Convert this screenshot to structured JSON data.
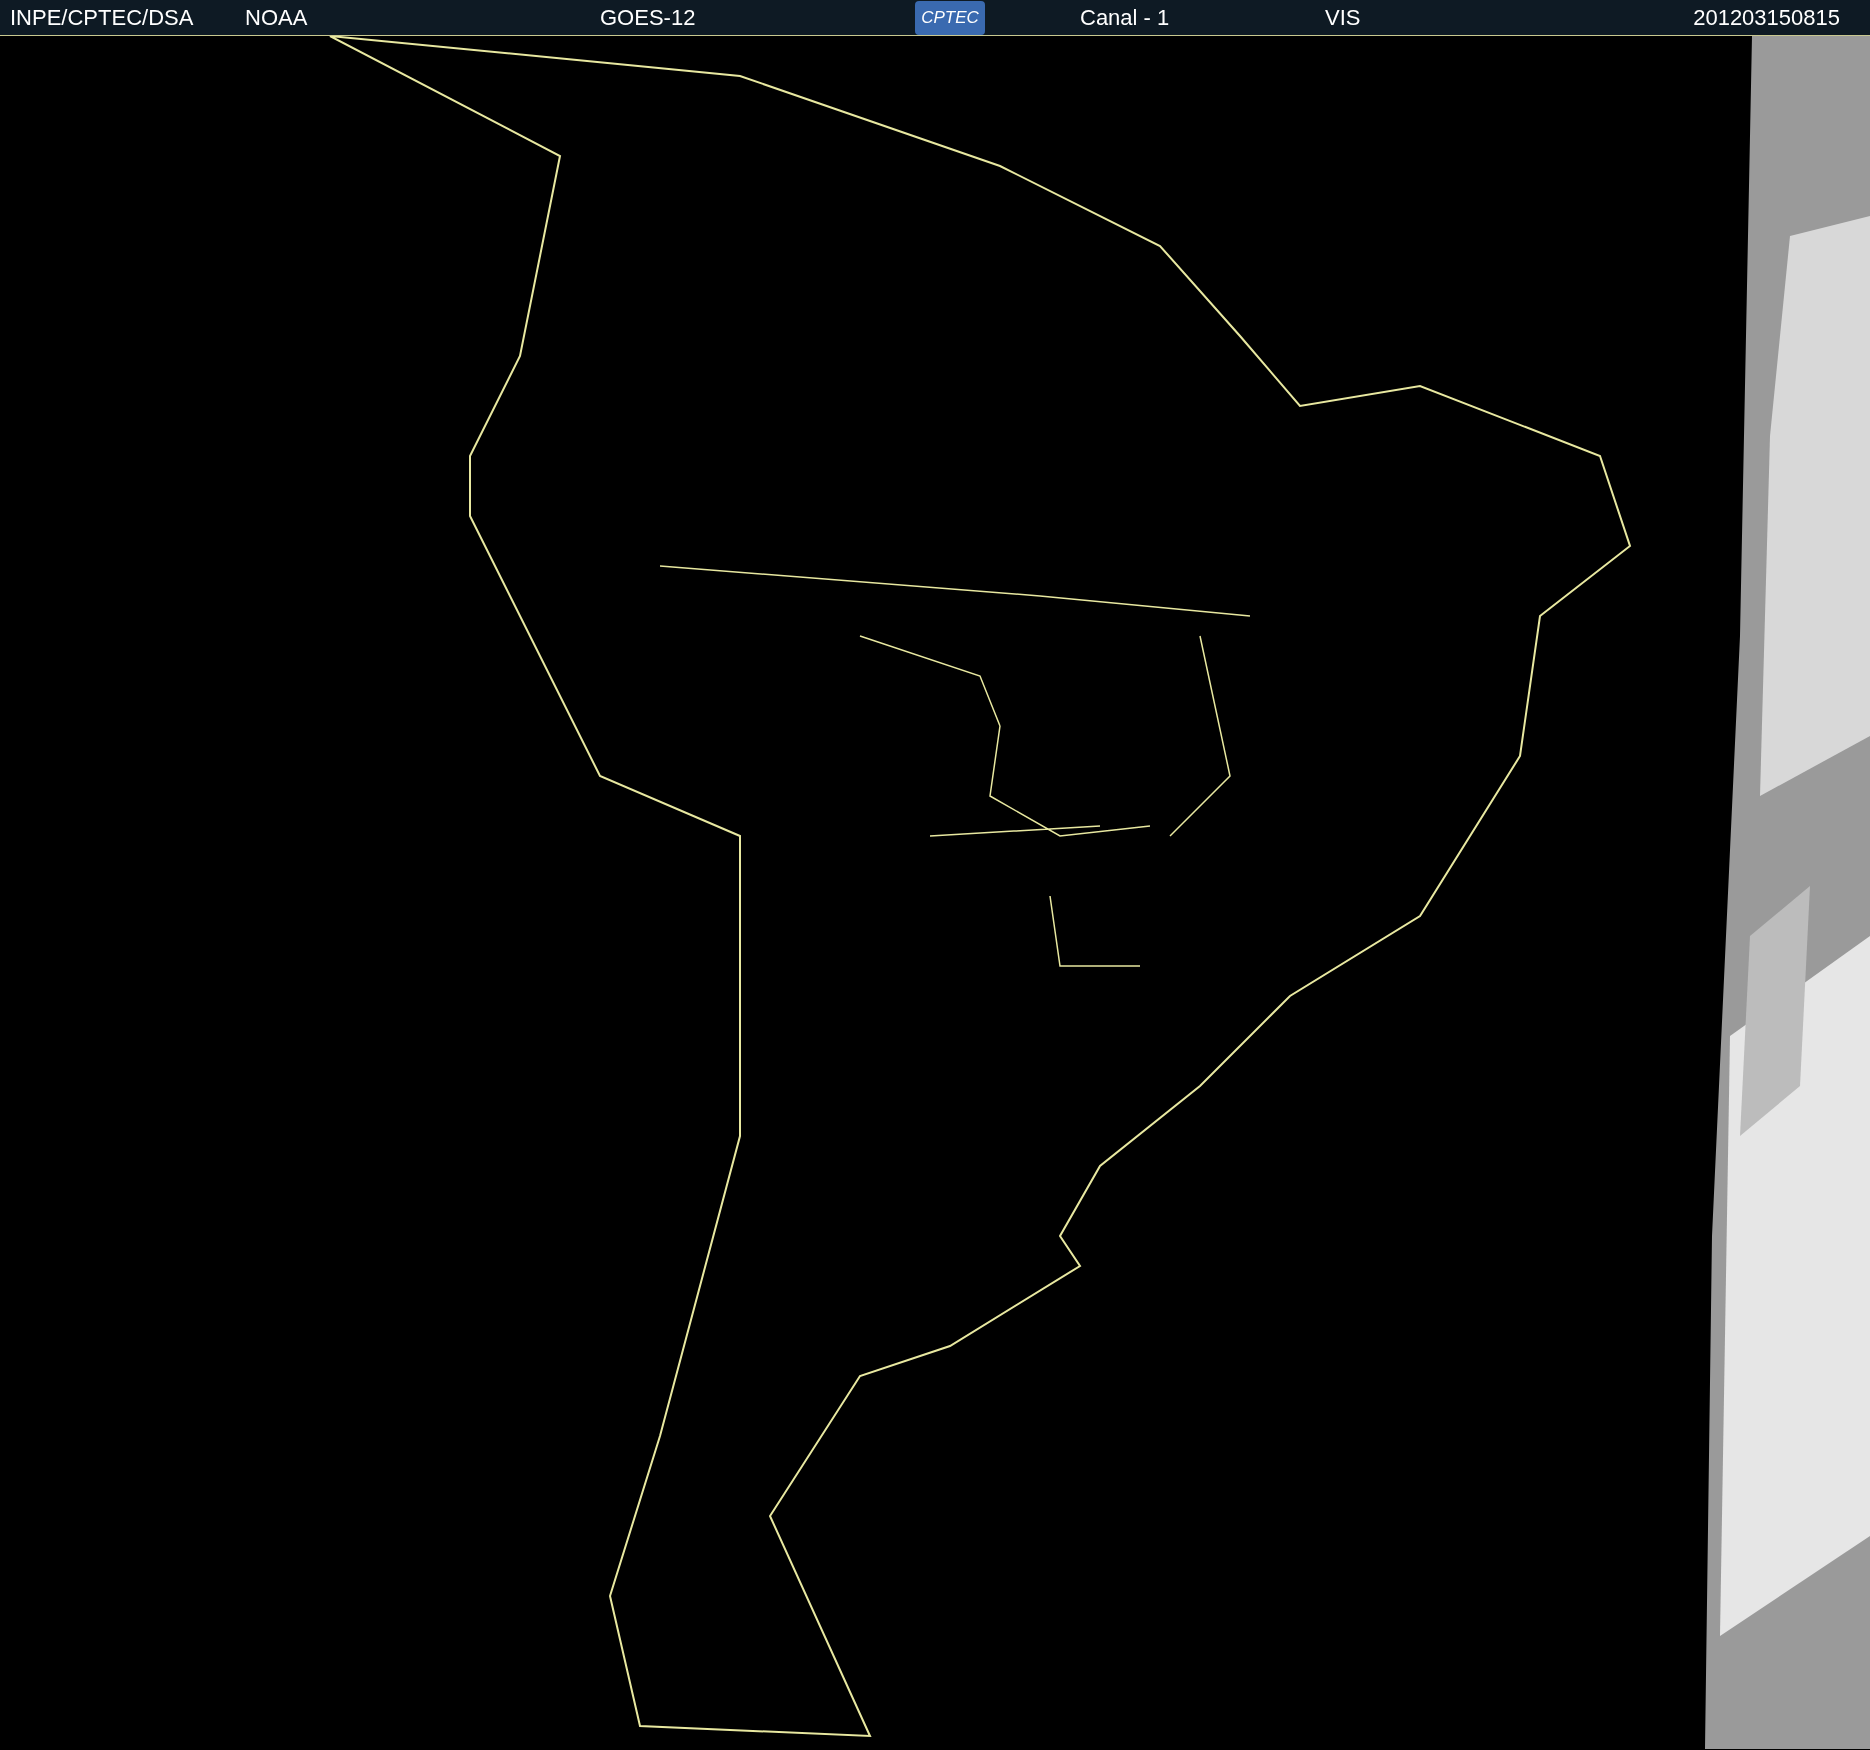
{
  "header": {
    "source": "INPE/CPTEC/DSA",
    "agency": "NOAA",
    "satellite": "GOES-12",
    "logo": "CPTEC",
    "channel": "Canal - 1",
    "band": "VIS",
    "timestamp": "201203150815"
  }
}
